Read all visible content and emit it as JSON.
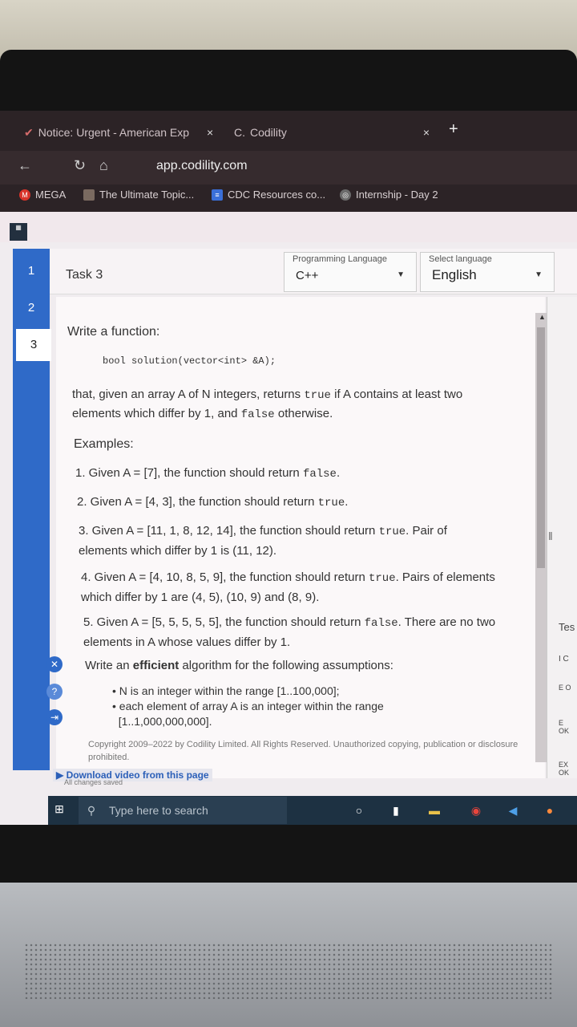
{
  "browser": {
    "tabs": [
      {
        "label": "Notice: Urgent - American Exp",
        "close": "×"
      },
      {
        "label": "Codility",
        "prefix": "C.",
        "close": "×"
      }
    ],
    "new_tab": "+",
    "url": "app.codility.com",
    "bookmarks": [
      "MEGA",
      "The Ultimate Topic...",
      "CDC Resources co...",
      "Internship - Day 2"
    ]
  },
  "app": {
    "task_numbers": [
      "1",
      "2",
      "3"
    ],
    "task_title": "Task 3",
    "programming_language": {
      "label": "Programming Language",
      "value": "C++"
    },
    "language": {
      "label": "Select language",
      "value": "English"
    },
    "right_labels": [
      "Tes",
      "I C",
      "E O",
      "E OK",
      "EX OK"
    ]
  },
  "task": {
    "intro": "Write a function:",
    "signature": "bool solution(vector<int> &A);",
    "desc_1": "that, given an array A of N integers, returns ",
    "desc_true": "true",
    "desc_2": " if A contains at least two",
    "desc_3": "elements which differ by 1, and ",
    "desc_false": "false",
    "desc_4": " otherwise.",
    "examples_heading": "Examples:",
    "ex1_a": "1. Given A = [7], the function should return ",
    "ex1_code": "false",
    "ex1_b": ".",
    "ex2_a": "2. Given A = [4, 3], the function should return ",
    "ex2_code": "true",
    "ex2_b": ".",
    "ex3_a": "3. Given A = [11, 1, 8, 12, 14], the function should return ",
    "ex3_code": "true",
    "ex3_b": ". Pair of",
    "ex3_line2": "elements which differ by 1 is (11, 12).",
    "ex4_a": "4. Given A = [4, 10, 8, 5, 9], the function should return ",
    "ex4_code": "true",
    "ex4_b": ". Pairs of elements",
    "ex4_line2": "which differ by 1 are (4, 5), (10, 9) and (8, 9).",
    "ex5_a": "5. Given A = [5, 5, 5, 5, 5], the function should return ",
    "ex5_code": "false",
    "ex5_b": ". There are no two",
    "ex5_line2": "elements in A whose values differ by 1.",
    "assump_a": "Write an ",
    "assump_bold": "efficient",
    "assump_b": " algorithm for the following assumptions:",
    "bullet_1": "N is an integer within the range [1..100,000];",
    "bullet_2a": "each element of array A is an integer within the range",
    "bullet_2b": "[1..1,000,000,000].",
    "copyright": "Copyright 2009–2022 by Codility Limited. All Rights Reserved. Unauthorized copying, publication or disclosure prohibited."
  },
  "overlay": {
    "download": "▶ Download video from this page",
    "saved": "All changes saved"
  },
  "taskbar": {
    "search_placeholder": "Type here to search"
  },
  "colors": {
    "sidebar": "#2f6ac8",
    "browser_dark": "#2c2326"
  }
}
